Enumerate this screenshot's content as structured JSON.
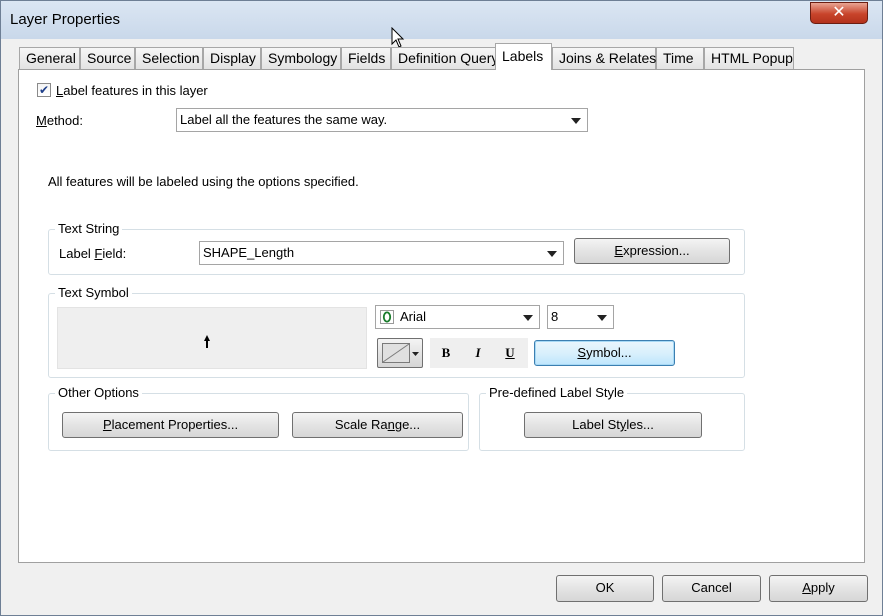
{
  "window": {
    "title": "Layer Properties",
    "close_glyph": "✕"
  },
  "tabs": [
    {
      "label": "General"
    },
    {
      "label": "Source"
    },
    {
      "label": "Selection"
    },
    {
      "label": "Display"
    },
    {
      "label": "Symbology"
    },
    {
      "label": "Fields"
    },
    {
      "label": "Definition Query"
    },
    {
      "label": "Labels",
      "active": true
    },
    {
      "label": "Joins & Relates"
    },
    {
      "label": "Time"
    },
    {
      "label": "HTML Popup"
    }
  ],
  "labels_tab": {
    "label_features": {
      "text_pre": "",
      "mnemonic": "L",
      "text_post": "abel features in this layer",
      "checked": true,
      "check_glyph": "✔"
    },
    "method": {
      "label_mnemonic": "M",
      "label_post": "ethod:",
      "value": "Label all the features the same way."
    },
    "description": "All features will be labeled using the options specified.",
    "text_string": {
      "group_label": "Text String",
      "field_label_pre": "Label ",
      "field_label_mnemonic": "F",
      "field_label_post": "ield:",
      "field_value": "SHAPE_Length",
      "expression_mnemonic": "E",
      "expression_post": "xpression..."
    },
    "text_symbol": {
      "group_label": "Text Symbol",
      "font_value": "Arial",
      "font_icon": "opentype-font-icon",
      "size_value": "8",
      "bold": "B",
      "italic": "I",
      "underline": "U",
      "symbol_mnemonic": "S",
      "symbol_post": "ymbol..."
    },
    "other_options": {
      "group_label": "Other Options",
      "placement_mnemonic": "P",
      "placement_post": "lacement Properties...",
      "scale_pre": "Scale Ra",
      "scale_mnemonic": "n",
      "scale_post": "ge..."
    },
    "predefined": {
      "group_label": "Pre-defined Label Style",
      "styles_pre": "Label St",
      "styles_mnemonic": "y",
      "styles_post": "les..."
    }
  },
  "footer": {
    "ok": "OK",
    "cancel": "Cancel",
    "apply_mnemonic": "A",
    "apply_post": "pply"
  }
}
